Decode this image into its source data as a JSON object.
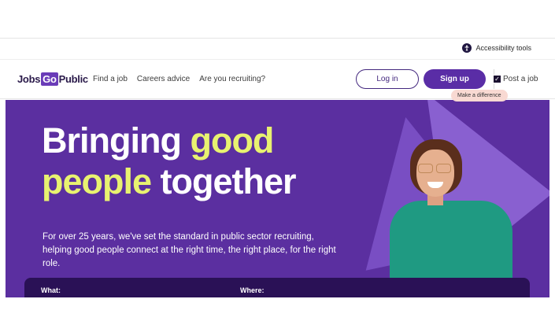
{
  "topbar": {
    "accessibility_label": "Accessibility tools"
  },
  "nav": {
    "logo_part1": "Jobs",
    "logo_part2": "Go",
    "logo_part3": "Public",
    "links": [
      "Find a job",
      "Careers advice",
      "Are you recruiting?"
    ],
    "login_label": "Log in",
    "signup_label": "Sign up",
    "post_job_label": "Post a job"
  },
  "hero": {
    "title_line1_white": "Bringing ",
    "title_line1_highlight": "good",
    "title_line2_highlight": "people",
    "title_line2_white": " together",
    "subtitle": "For over 25 years, we've set the standard in public sector recruiting, helping good people connect at the right time, the right place, for the right role.",
    "badge": "Make a difference",
    "check_mark": "✓"
  },
  "search": {
    "what_label": "What:",
    "where_label": "Where:"
  },
  "colors": {
    "hero_bg": "#5b2fa0",
    "highlight": "#e8f270",
    "brand_purple": "#5a2da6",
    "search_bg": "#2a1156"
  }
}
